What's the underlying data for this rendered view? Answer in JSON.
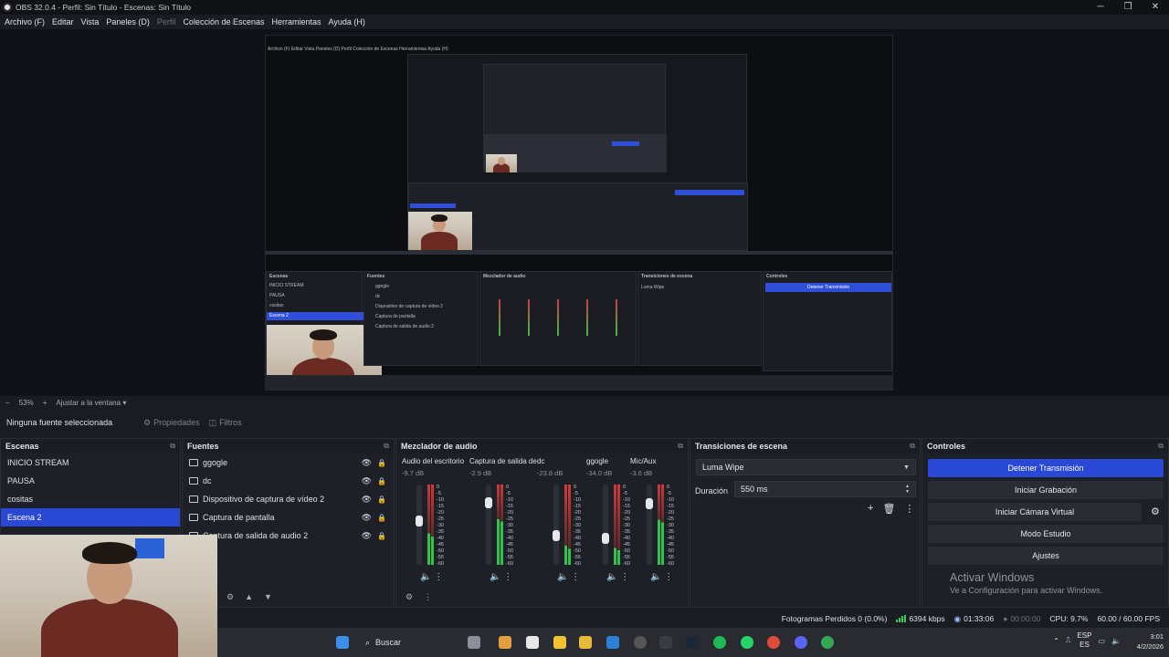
{
  "window": {
    "title": "OBS 32.0.4 - Perfil: Sin Título - Escenas: Sin Título",
    "controls": [
      "─",
      "❐",
      "✕"
    ]
  },
  "menu": [
    {
      "label": "Archivo (F)",
      "disabled": false
    },
    {
      "label": "Editar",
      "disabled": false
    },
    {
      "label": "Vista",
      "disabled": false
    },
    {
      "label": "Paneles (D)",
      "disabled": false
    },
    {
      "label": "Perfil",
      "disabled": true
    },
    {
      "label": "Colección de Escenas",
      "disabled": false
    },
    {
      "label": "Herramientas",
      "disabled": false
    },
    {
      "label": "Ayuda (H)",
      "disabled": false
    }
  ],
  "zoom": {
    "minus": "−",
    "value": "53%",
    "plus": "+",
    "fit": "Ajustar a la ventana"
  },
  "source_bar": {
    "no_selection": "Ninguna fuente seleccionada",
    "properties": "Propiedades",
    "filters": "Filtros"
  },
  "scenes": {
    "title": "Escenas",
    "items": [
      "INICIO STREAM",
      "PAUSA",
      "cositas",
      "Escena 2"
    ],
    "selected_index": 3
  },
  "sources": {
    "title": "Fuentes",
    "items": [
      "ggogle",
      "dc",
      "Dispositivo de captura de vídeo 2",
      "Captura de pantalla",
      "Captura de salida de audio 2"
    ]
  },
  "mixer": {
    "title": "Mezclador de audio",
    "channels": [
      {
        "name": "Audio del escritorio",
        "db": "-9.7 dB",
        "level": 0.55
      },
      {
        "name": "Captura de salida de",
        "db": "-2.9 dB",
        "level": 0.82
      },
      {
        "name": "dc",
        "db": "-23.8 dB",
        "level": 0.34
      },
      {
        "name": "ggogle",
        "db": "-34.0 dB",
        "level": 0.3
      },
      {
        "name": "Mic/Aux",
        "db": "-3.6 dB",
        "level": 0.8
      }
    ],
    "scale": [
      "0",
      "-5",
      "-10",
      "-15",
      "-20",
      "-25",
      "-30",
      "-35",
      "-40",
      "-45",
      "-50",
      "-55",
      "-60"
    ]
  },
  "transitions": {
    "title": "Transiciones de escena",
    "selected": "Luma Wipe",
    "duration_label": "Duración",
    "duration_value": "550 ms"
  },
  "controls": {
    "title": "Controles",
    "buttons": [
      "Detener Transmisión",
      "Iniciar Grabación",
      "Iniciar Cámara Virtual",
      "Modo Estudio",
      "Ajustes"
    ]
  },
  "watermark": {
    "line1": "Activar Windows",
    "line2": "Ve a Configuración para activar Windows."
  },
  "status": {
    "dropped": "Fotogramas Perdidos 0 (0.0%)",
    "bitrate": "6394 kbps",
    "stream_time": "01:33:06",
    "rec_time": "00:00:00",
    "cpu": "CPU: 9.7%",
    "fps": "60.00 / 60.00 FPS"
  },
  "taskbar": {
    "search": "Buscar",
    "lang1": "ESP",
    "lang2": "ES",
    "time": "3:01",
    "date": "4/2/2026"
  },
  "preview_mini": {
    "menu": "Archivo (F)  Editar  Vista  Paneles (D)  Perfil  Colección de Escenas  Herramientas  Ayuda (H)",
    "scenes_title": "Escenas",
    "sources_title": "Fuentes",
    "mixer_title": "Mezclador de audio",
    "transitions_title": "Transiciones de escena",
    "controls_title": "Controles",
    "stop_label": "Detener Transmisión"
  },
  "colors": {
    "accent": "#2a48d6",
    "meter_green": "#33c24a",
    "meter_red": "#d23a3a"
  }
}
